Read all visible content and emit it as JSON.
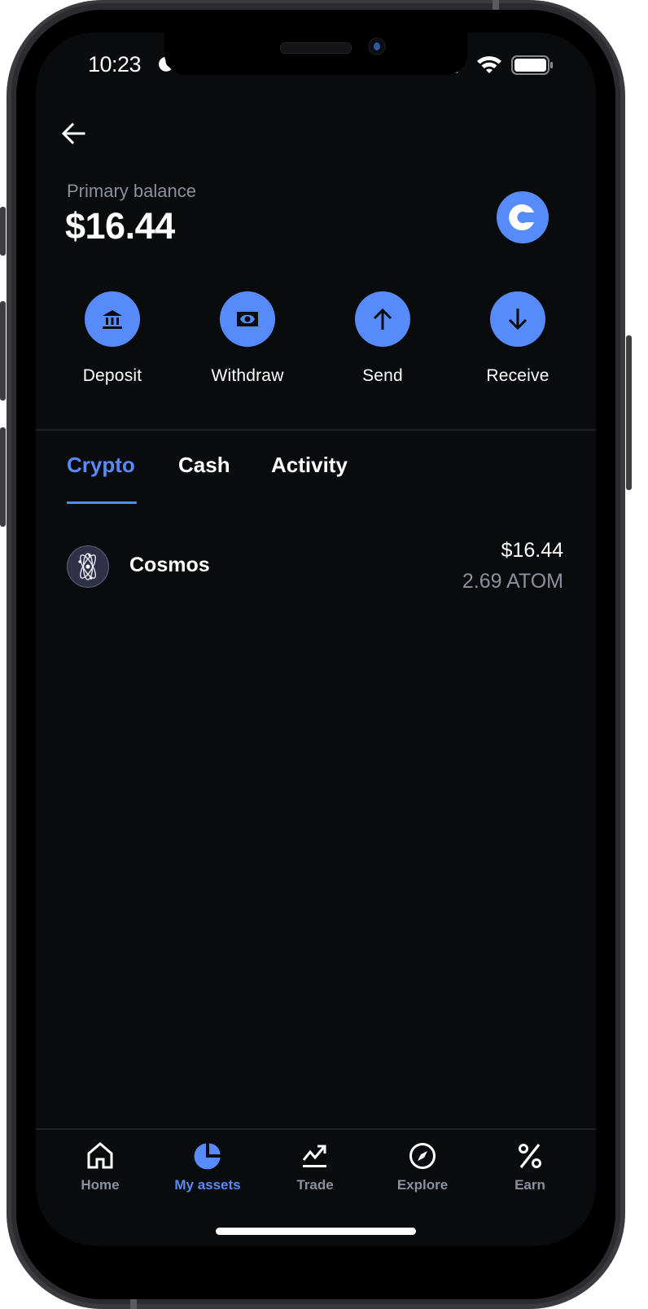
{
  "status_bar": {
    "time": "10:23",
    "moon_icon": "moon-icon",
    "signal_icon": "signal-icon",
    "wifi_icon": "wifi-icon",
    "battery_icon": "battery-icon"
  },
  "header": {
    "back_icon": "arrow-left-icon",
    "balance_label": "Primary balance",
    "balance_value": "$16.44",
    "logo_icon": "coinbase-logo-icon"
  },
  "actions": [
    {
      "label": "Deposit",
      "icon": "bank-icon"
    },
    {
      "label": "Withdraw",
      "icon": "cash-icon"
    },
    {
      "label": "Send",
      "icon": "arrow-up-icon"
    },
    {
      "label": "Receive",
      "icon": "arrow-down-icon"
    }
  ],
  "tabs": [
    {
      "label": "Crypto",
      "active": true
    },
    {
      "label": "Cash",
      "active": false
    },
    {
      "label": "Activity",
      "active": false
    }
  ],
  "assets": [
    {
      "name": "Cosmos",
      "icon": "cosmos-atom-icon",
      "fiat_value": "$16.44",
      "amount": "2.69 ATOM"
    }
  ],
  "bottom_nav": [
    {
      "label": "Home",
      "icon": "home-icon",
      "active": false
    },
    {
      "label": "My assets",
      "icon": "pie-chart-icon",
      "active": true
    },
    {
      "label": "Trade",
      "icon": "trade-chart-icon",
      "active": false
    },
    {
      "label": "Explore",
      "icon": "compass-icon",
      "active": false
    },
    {
      "label": "Earn",
      "icon": "percent-icon",
      "active": false
    }
  ],
  "colors": {
    "accent": "#578bfa",
    "background": "#0a0b0d",
    "text_primary": "#ffffff",
    "text_secondary": "#8a919e"
  }
}
